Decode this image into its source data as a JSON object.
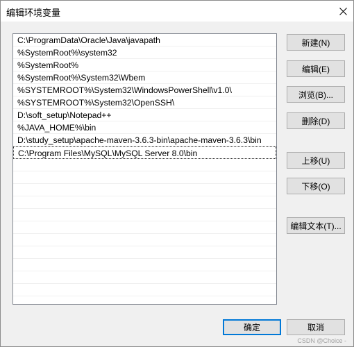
{
  "window": {
    "title": "编辑环境变量",
    "close_icon": "close-icon"
  },
  "path_list": {
    "items": [
      "C:\\ProgramData\\Oracle\\Java\\javapath",
      "%SystemRoot%\\system32",
      "%SystemRoot%",
      "%SystemRoot%\\System32\\Wbem",
      "%SYSTEMROOT%\\System32\\WindowsPowerShell\\v1.0\\",
      "%SYSTEMROOT%\\System32\\OpenSSH\\",
      "D:\\soft_setup\\Notepad++",
      "%JAVA_HOME%\\bin",
      "D:\\study_setup\\apache-maven-3.6.3-bin\\apache-maven-3.6.3\\bin",
      "C:\\Program Files\\MySQL\\MySQL Server 8.0\\bin"
    ],
    "selected_index": 9
  },
  "side_buttons": {
    "new": "新建(N)",
    "edit": "编辑(E)",
    "browse": "浏览(B)...",
    "delete": "删除(D)",
    "move_up": "上移(U)",
    "move_down": "下移(O)",
    "edit_text": "编辑文本(T)..."
  },
  "footer": {
    "ok": "确定",
    "cancel": "取消"
  },
  "watermark": "CSDN @Choice -",
  "colors": {
    "dialog_bg": "#f0f0f0",
    "list_bg": "#ffffff",
    "button_bg": "#e1e1e1",
    "default_button_border": "#0078d7"
  }
}
